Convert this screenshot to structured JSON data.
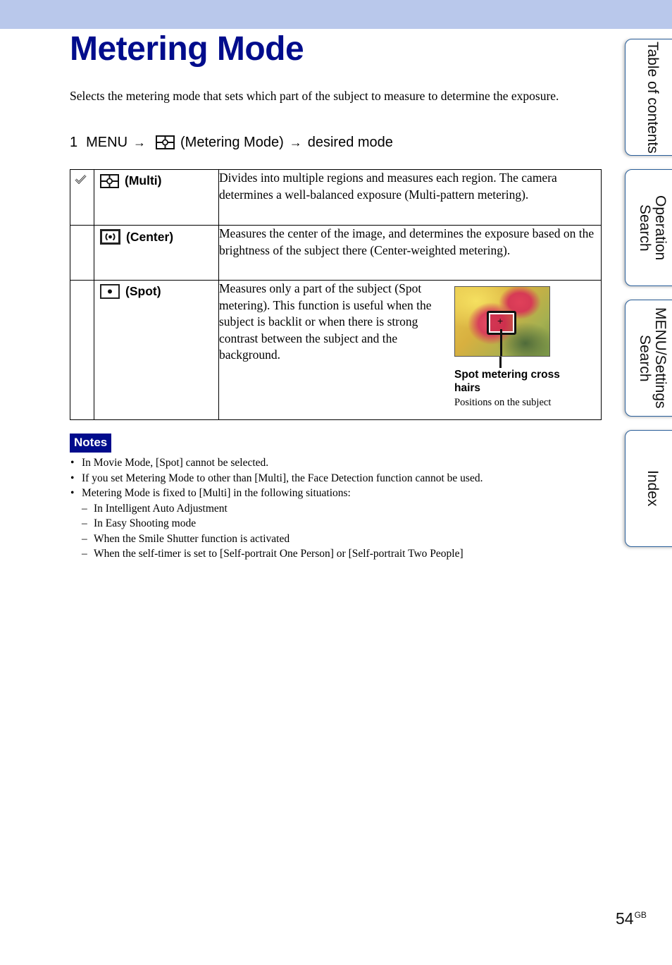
{
  "header": {
    "band_color": "#b9c8eb",
    "title": "Metering Mode",
    "title_color": "#000c8c"
  },
  "intro": "Selects the metering mode that sets which part of the subject to measure to determine the exposure.",
  "step": {
    "number": "1",
    "menu": "MENU",
    "arrow": "→",
    "icon": "metering-multi-icon",
    "item": "(Metering Mode)",
    "target": "desired mode"
  },
  "modes": [
    {
      "selected": true,
      "icon": "metering-multi-icon",
      "label": "(Multi)",
      "description": "Divides into multiple regions and measures each region. The camera determines a well-balanced exposure (Multi-pattern metering)."
    },
    {
      "selected": false,
      "icon": "metering-center-icon",
      "label": "(Center)",
      "description": "Measures the center of the image, and determines the exposure based on the brightness of the subject there (Center-weighted metering)."
    },
    {
      "selected": false,
      "icon": "metering-spot-icon",
      "label": "(Spot)",
      "description": "Measures only a part of the subject (Spot metering). This function is useful when the subject is backlit or when there is strong contrast between the subject and the background.",
      "figure": {
        "caption": "Spot metering cross hairs",
        "subcaption": "Positions on the subject",
        "crosshair": "+"
      }
    }
  ],
  "notes": {
    "badge": "Notes",
    "items": [
      {
        "level": 1,
        "bullet": "•",
        "text": "In Movie Mode, [Spot] cannot be selected."
      },
      {
        "level": 1,
        "bullet": "•",
        "text": "If you set Metering Mode to other than [Multi], the Face Detection function cannot be used."
      },
      {
        "level": 1,
        "bullet": "•",
        "text": "Metering Mode is fixed to [Multi] in the following situations:"
      },
      {
        "level": 2,
        "bullet": "–",
        "text": "In Intelligent Auto Adjustment"
      },
      {
        "level": 2,
        "bullet": "–",
        "text": "In Easy Shooting mode"
      },
      {
        "level": 2,
        "bullet": "–",
        "text": "When the Smile Shutter function is activated"
      },
      {
        "level": 2,
        "bullet": "–",
        "text": "When the self-timer is set to [Self-portrait One Person] or [Self-portrait Two People]"
      }
    ]
  },
  "side_tabs": [
    {
      "label": "Table of contents"
    },
    {
      "label": "Operation Search"
    },
    {
      "label": "MENU/Settings Search"
    },
    {
      "label": "Index"
    }
  ],
  "page": {
    "number": "54",
    "suffix": "GB"
  }
}
